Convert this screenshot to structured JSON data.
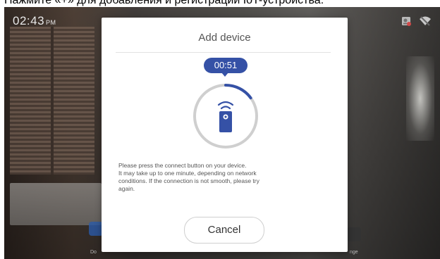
{
  "caption": {
    "text": "Нажмите «+» для добавления и регистрации IoT-устройства."
  },
  "status_bar": {
    "time": "02:43",
    "ampm": "PM",
    "icons": [
      "contact-card-icon",
      "wifi-off-icon"
    ]
  },
  "background": {
    "dock": {
      "labels": [
        "Do",
        "nge"
      ]
    }
  },
  "modal": {
    "title": "Add device",
    "timer": "00:51",
    "progress_fraction": 0.15,
    "accent_color": "#3551a6",
    "icon": "remote-control-icon",
    "instructions": [
      "Please press the connect button on your device.",
      "It may take up to one minute, depending on network",
      "conditions. If the connection is not smooth, please try",
      "again."
    ],
    "cancel_label": "Cancel"
  }
}
